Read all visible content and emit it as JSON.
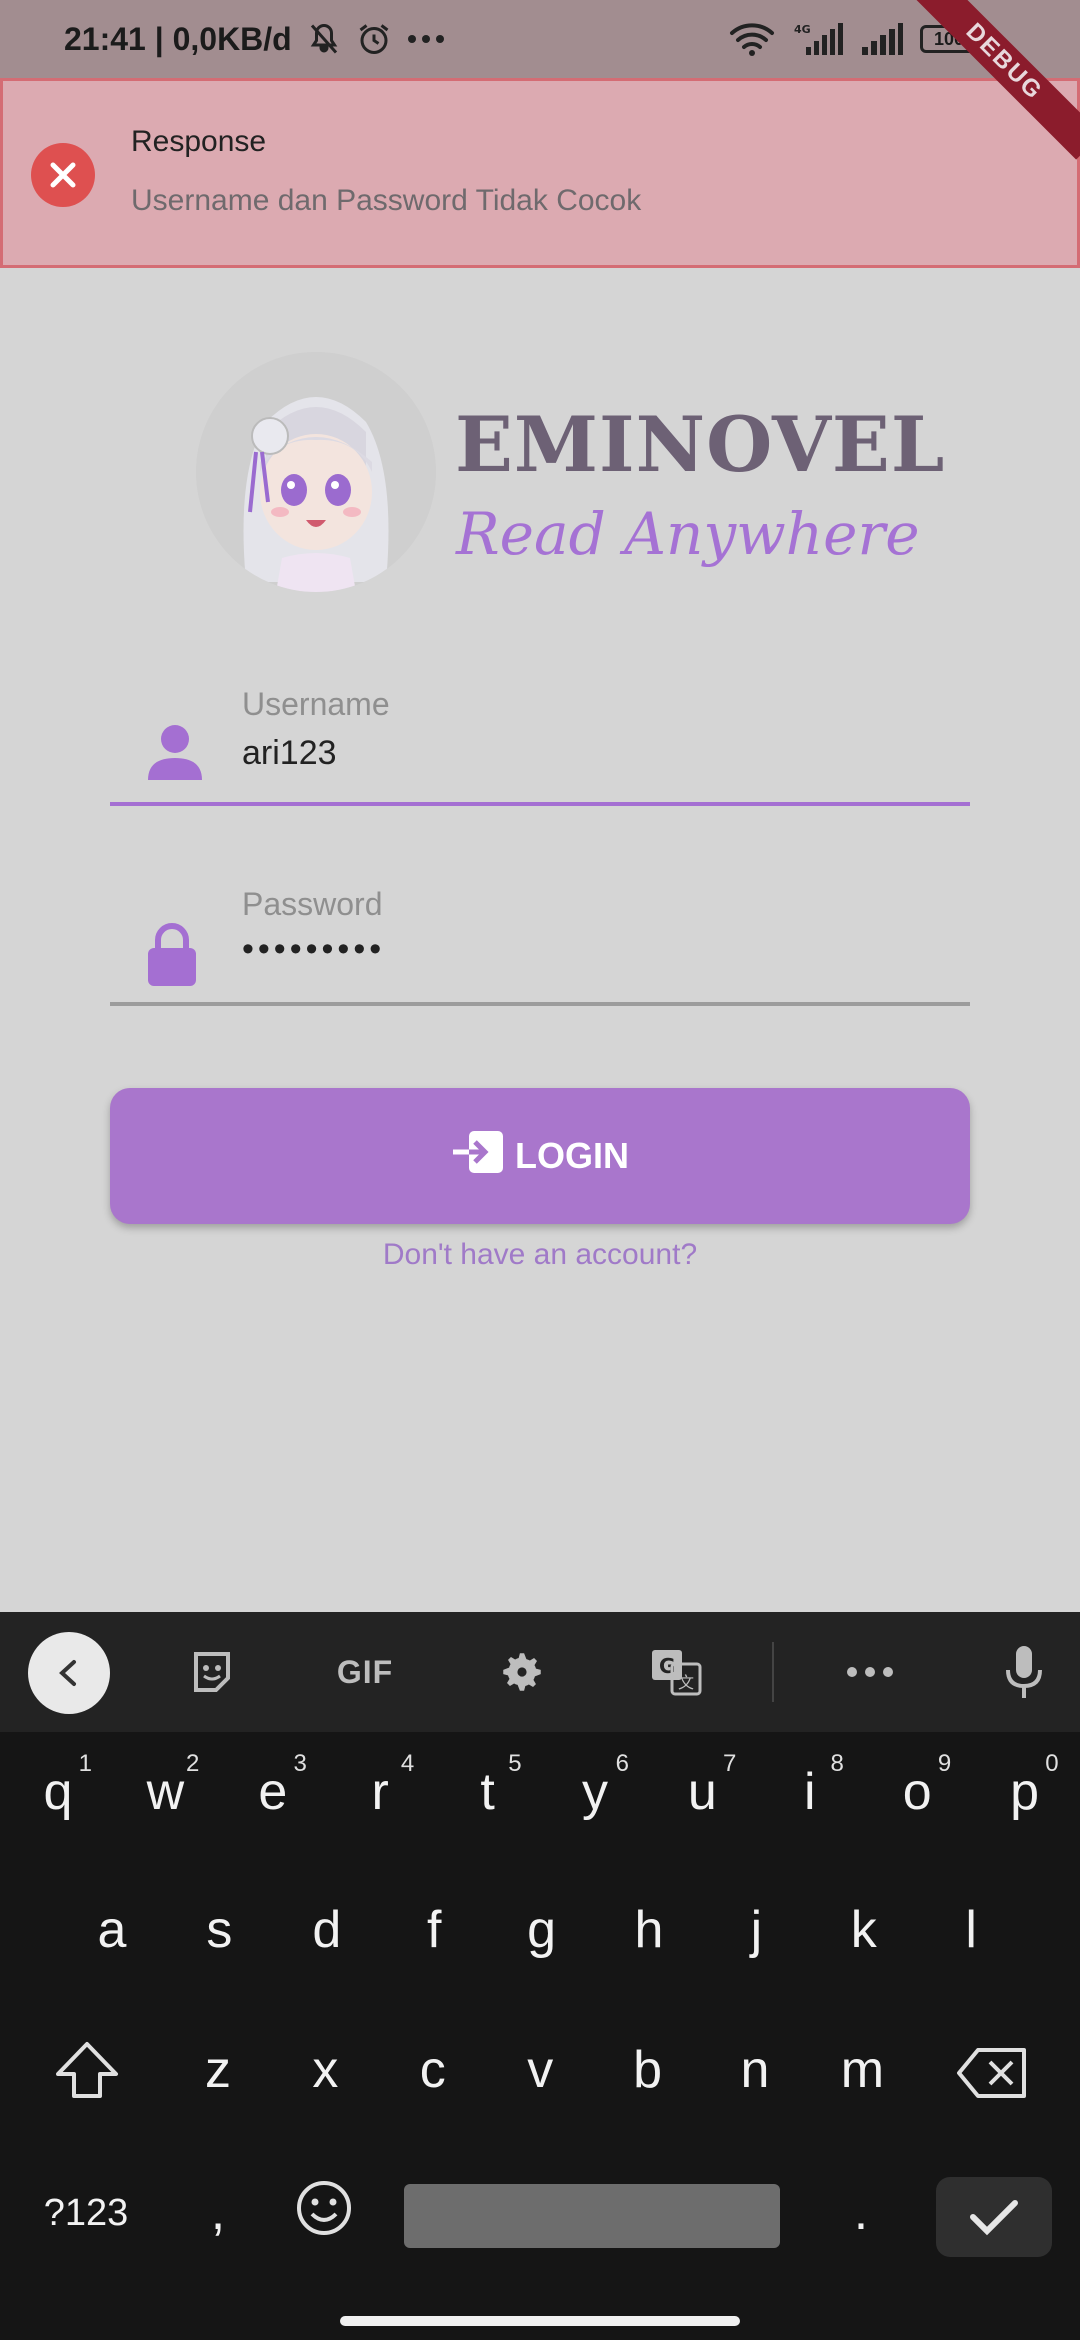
{
  "status_bar": {
    "time_network": "21:41 | 0,0KB/d",
    "battery": "100",
    "debug_label": "DEBUG"
  },
  "toast": {
    "title": "Response",
    "message": "Username dan Password Tidak Cocok",
    "color": "#de5050"
  },
  "app": {
    "title": "EMINOVEL",
    "tagline": "Read Anywhere",
    "accent_color": "#a976cc"
  },
  "form": {
    "username": {
      "label": "Username",
      "value": "ari123",
      "icon": "person-icon"
    },
    "password": {
      "label": "Password",
      "value": "•••••••••",
      "icon": "lock-icon"
    },
    "login_label": "LOGIN",
    "login_icon": "login-icon",
    "signup_link": "Don't have an account?"
  },
  "keyboard": {
    "toolbar": {
      "gif": "GIF",
      "icons": [
        "back-icon",
        "sticker-icon",
        "gif",
        "settings-icon",
        "translate-icon",
        "more-icon",
        "mic-icon"
      ]
    },
    "row1": [
      {
        "k": "q",
        "h": "1"
      },
      {
        "k": "w",
        "h": "2"
      },
      {
        "k": "e",
        "h": "3"
      },
      {
        "k": "r",
        "h": "4"
      },
      {
        "k": "t",
        "h": "5"
      },
      {
        "k": "y",
        "h": "6"
      },
      {
        "k": "u",
        "h": "7"
      },
      {
        "k": "i",
        "h": "8"
      },
      {
        "k": "o",
        "h": "9"
      },
      {
        "k": "p",
        "h": "0"
      }
    ],
    "row2": [
      "a",
      "s",
      "d",
      "f",
      "g",
      "h",
      "j",
      "k",
      "l"
    ],
    "row3": [
      "z",
      "x",
      "c",
      "v",
      "b",
      "n",
      "m"
    ],
    "symbols_key": "?123",
    "comma_key": ",",
    "period_key": "."
  }
}
